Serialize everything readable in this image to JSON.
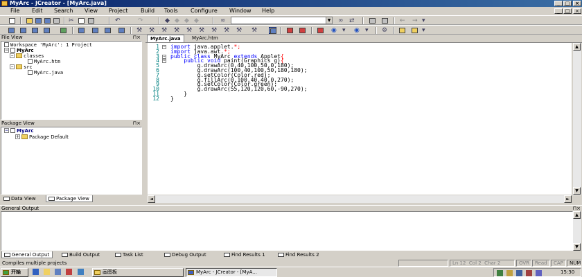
{
  "window": {
    "title": "MyArc - JCreator - [MyArc.java]"
  },
  "menu": [
    "File",
    "Edit",
    "Search",
    "View",
    "Project",
    "Build",
    "Tools",
    "Configure",
    "Window",
    "Help"
  ],
  "file_view": {
    "title": "File View",
    "workspace": "Workspace 'MyArc': 1 Project",
    "project": "MyArc",
    "items": [
      "classes",
      "MyArc.htm",
      "src",
      "MyArc.java"
    ]
  },
  "package_view": {
    "title": "Package View",
    "project": "MyArc",
    "items": [
      "Package Default"
    ]
  },
  "left_tabs": [
    "Data View",
    "Package View"
  ],
  "editor": {
    "tabs": [
      "MyArc.java",
      "MyArc.htm"
    ],
    "lines": [
      [
        {
          "t": "import",
          "c": "kw"
        },
        {
          "t": " java.applet.",
          "c": ""
        },
        {
          "t": "*;",
          "c": "sy"
        }
      ],
      [
        {
          "t": "import",
          "c": "kw"
        },
        {
          "t": " java.awt.",
          "c": ""
        },
        {
          "t": "*;",
          "c": "sy"
        }
      ],
      [
        {
          "t": "public",
          "c": "kw"
        },
        {
          "t": " ",
          "c": ""
        },
        {
          "t": "class",
          "c": "kw"
        },
        {
          "t": " MyArc ",
          "c": ""
        },
        {
          "t": "extends",
          "c": "kw"
        },
        {
          "t": " Applet",
          "c": ""
        },
        {
          "t": "{",
          "c": "sy"
        }
      ],
      [
        {
          "t": "    ",
          "c": ""
        },
        {
          "t": "public",
          "c": "kw"
        },
        {
          "t": " ",
          "c": ""
        },
        {
          "t": "void",
          "c": "kw"
        },
        {
          "t": " paint(Graphics g)",
          "c": ""
        },
        {
          "t": "{",
          "c": "sy"
        }
      ],
      [
        {
          "t": "        g.drawArc(0,40,100,50,0,180);",
          "c": ""
        }
      ],
      [
        {
          "t": "        g.drawArc(100,40,100,50,180,180);",
          "c": ""
        }
      ],
      [
        {
          "t": "        g.setColor(Color.red);",
          "c": ""
        }
      ],
      [
        {
          "t": "        g.fillArc(0,100,40,40,0,270);",
          "c": ""
        }
      ],
      [
        {
          "t": "        g.setColor(Color.green);",
          "c": ""
        }
      ],
      [
        {
          "t": "        g.drawArc(55,120,120,60,-90,270);",
          "c": ""
        }
      ],
      [
        {
          "t": "    }",
          "c": ""
        }
      ],
      [
        {
          "t": "}",
          "c": ""
        }
      ]
    ]
  },
  "output": {
    "title": "General Output",
    "tabs": [
      "General Output",
      "Build Output",
      "Task List",
      "Debug Output",
      "Find Results 1",
      "Find Results 2"
    ]
  },
  "status": {
    "message": "Compiles multiple projects",
    "ln": "Ln 12",
    "col": "Col 2",
    "ch": "Char 2",
    "ovr": "OVR",
    "read": "Read",
    "cap": "CAP",
    "num": "NUM"
  },
  "taskbar": {
    "start": "开始",
    "paint": "画图板",
    "jcreator": "MyArc - JCreator - [MyA...",
    "time": "15:30"
  }
}
